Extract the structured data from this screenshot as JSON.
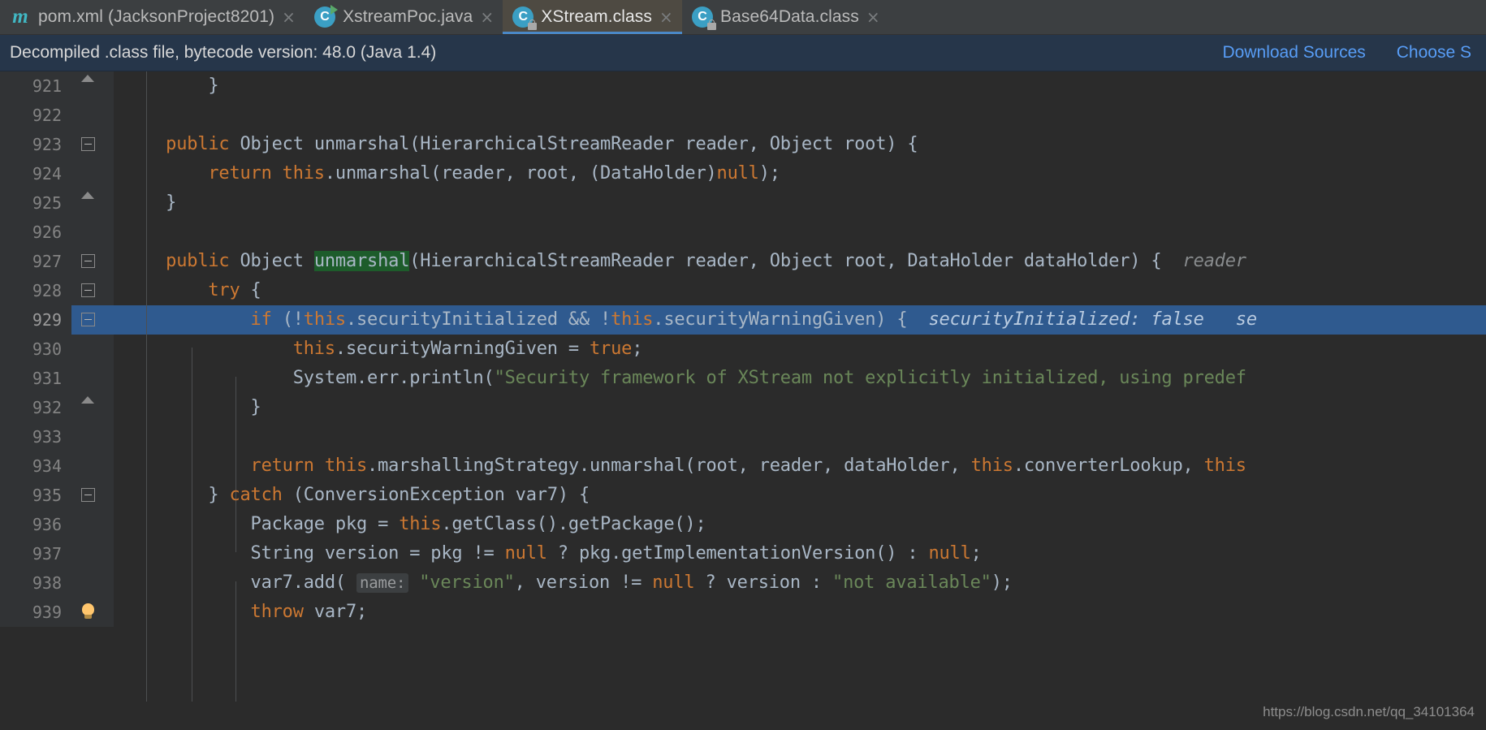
{
  "tabs": [
    {
      "label": "pom.xml (JacksonProject8201)",
      "icon": "maven-icon",
      "active": false,
      "close": "×"
    },
    {
      "label": "XstreamPoc.java",
      "icon": "java-class-run-icon",
      "active": false,
      "close": "×"
    },
    {
      "label": "XStream.class",
      "icon": "java-class-locked-icon",
      "active": true,
      "close": "×"
    },
    {
      "label": "Base64Data.class",
      "icon": "java-class-locked-icon",
      "active": false,
      "close": "×"
    }
  ],
  "notification": {
    "message": "Decompiled .class file, bytecode version: 48.0 (Java 1.4)",
    "download_sources": "Download Sources",
    "choose_sources": "Choose S"
  },
  "editor": {
    "lines": [
      {
        "num": "921",
        "text": "        }"
      },
      {
        "num": "922",
        "text": ""
      },
      {
        "num": "923",
        "text": "    public Object unmarshal(HierarchicalStreamReader reader, Object root) {"
      },
      {
        "num": "924",
        "text": "        return this.unmarshal(reader, root, (DataHolder)null);"
      },
      {
        "num": "925",
        "text": "    }"
      },
      {
        "num": "926",
        "text": ""
      },
      {
        "num": "927",
        "text": "    public Object unmarshal(HierarchicalStreamReader reader, Object root, DataHolder dataHolder) {",
        "hint": "reader"
      },
      {
        "num": "928",
        "text": "        try {"
      },
      {
        "num": "929",
        "text": "            if (!this.securityInitialized && !this.securityWarningGiven) {",
        "hint": "securityInitialized: false   se",
        "current": true
      },
      {
        "num": "930",
        "text": "                this.securityWarningGiven = true;"
      },
      {
        "num": "931",
        "text": "                System.err.println(\"Security framework of XStream not explicitly initialized, using predef"
      },
      {
        "num": "932",
        "text": "            }"
      },
      {
        "num": "933",
        "text": ""
      },
      {
        "num": "934",
        "text": "            return this.marshallingStrategy.unmarshal(root, reader, dataHolder, this.converterLookup, this"
      },
      {
        "num": "935",
        "text": "        } catch (ConversionException var7) {"
      },
      {
        "num": "936",
        "text": "            Package pkg = this.getClass().getPackage();"
      },
      {
        "num": "937",
        "text": "            String version = pkg != null ? pkg.getImplementationVersion() : null;"
      },
      {
        "num": "938",
        "text": "            var7.add( name: \"version\", version != null ? version : \"not available\");",
        "param_hint": "name:"
      },
      {
        "num": "939",
        "text": "            throw var7;"
      }
    ],
    "highlighted_token": "unmarshal",
    "current_line": "929",
    "debug_hint_929": "securityInitialized: false   se",
    "debug_hint_927": "reader"
  },
  "watermark": "https://blog.csdn.net/qq_34101364",
  "colors": {
    "tab_active_bg": "#4e4a42",
    "tab_bar_bg": "#3c3f41",
    "notification_bg": "#26364a",
    "link": "#589df6",
    "editor_bg": "#2b2b2b",
    "gutter_bg": "#313335",
    "current_line_bg": "#2f5a8f",
    "keyword": "#cc7832",
    "string": "#6a8759",
    "identifier": "#a9b7c6",
    "search_highlight": "#1d5c2b"
  }
}
